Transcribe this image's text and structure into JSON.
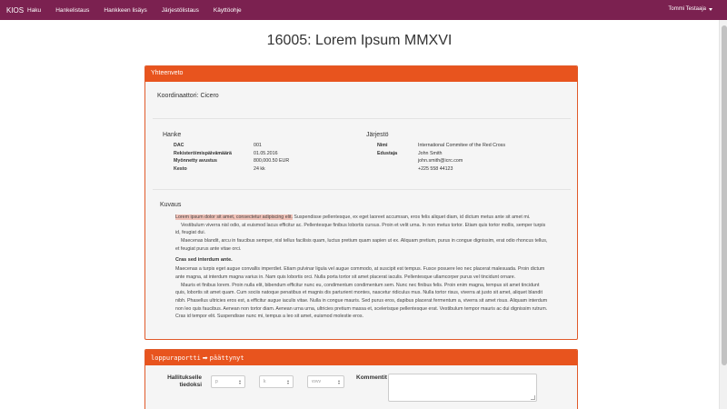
{
  "navbar": {
    "brand": "KIOS",
    "items": [
      "Haku",
      "Hankelistaus",
      "Hankkeen lisäys",
      "Järjestölistaus",
      "Käyttöohje"
    ],
    "user": "Tommi Testaaja"
  },
  "page": {
    "title": "16005: Lorem Ipsum MMXVI"
  },
  "summary": {
    "heading": "Yhteenveto",
    "coordinator": "Koordinaattori: Cicero",
    "project": {
      "title": "Hanke",
      "rows": [
        {
          "key": "DAC",
          "value": "001"
        },
        {
          "key": "Rekisteröimispäivämäärä",
          "value": "01.05.2016"
        },
        {
          "key": "Myönnetty avustus",
          "value": "800,000.50 EUR"
        },
        {
          "key": "Kesto",
          "value": "24 kk"
        }
      ]
    },
    "organization": {
      "title": "Järjestö",
      "rows": [
        {
          "key": "Nimi",
          "value": "International Commitee of the Red Cross"
        },
        {
          "key": "Edustaja",
          "value": "John Smith"
        },
        {
          "key": "",
          "value": "john.smith@icrc.com"
        },
        {
          "key": "",
          "value": "+225 558 44123"
        }
      ]
    },
    "description": {
      "title": "Kuvaus",
      "highlight": "Lorem ipsum dolor sit amet, consectetur adipiscing elit.",
      "p1_rest": " Suspendisse pellentesque, ex eget laoreet accumsan, eros felis aliquet diam, id dictum metus ante sit amet mi.",
      "p2": "Vestibulum viverra nisl odio, at euismod lacus efficitur ac. Pellentesque finibus lobortis cursus. Proin et velit urna. In non metus tortor. Etiam quis tortor mollis, semper turpis id, feugiat dui.",
      "p3": "Maecenas blandit, arcu in faucibus semper, nisl tellus facilisis quam, luctus pretium quam sapien ut ex. Aliquam pretium, purus in congue dignissim, erat odio rhoncus tellus, et feugiat purus ante vitae orci.",
      "subheading": "Cras sed interdum ante.",
      "p4": "Maecenas a turpis eget augue convallis imperdiet. Etiam pulvinar ligula vel augue commodo, at suscipit est tempus. Fusce posuere leo nec placerat malesuada. Proin dictum ante magna, at interdum magna varius in. Nam quis lobortis orci. Nulla porta tortor sit amet placerat iaculis. Pellentesque ullamcorper purus vel tincidunt ornare.",
      "p5": "Mauris et finibus lorem. Proin nulla elit, bibendum efficitur nunc eu, condimentum condimentum sem. Nunc nec finibus felis. Proin enim magna, tempus sit amet tincidunt quis, lobortis sit amet quam. Cum sociis natoque penatibus et magnis dis parturient montes, nascetur ridiculus mus. Nulla tortor risus, viverra at justo sit amet, aliquet blandit nibh. Phasellus ultricies eros est, a efficitur augue iaculis vitae. Nulla in congue mauris. Sed purus eros, dapibus placerat fermentum a, viverra sit amet risus. Aliquam interdum non leo quis faucibus. Aenean non tortor diam. Aenean urna urna, ultricies pretium massa et, scelerisque pellentesque erat. Vestibulum tempor mauris ac dui dignissim rutrum. Cras id tempor elit. Suspendisse nunc mi, tempus a leo sit amet, euismod molestie eros."
    }
  },
  "report": {
    "status_from": "loppuraportti",
    "status_to": "päättynyt",
    "field_label": "Hallitukselle tiedoksi",
    "day_placeholder": "p",
    "month_placeholder": "k",
    "year_placeholder": "vvvv",
    "comment_label": "Kommentit"
  },
  "colors": {
    "navbar": "#7b2150",
    "panel_heading": "#e8541e",
    "highlight": "#f1c2b8"
  }
}
